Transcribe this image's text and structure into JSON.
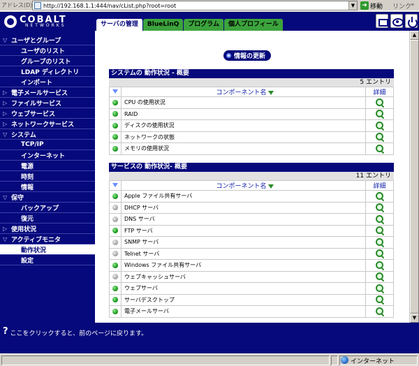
{
  "browser": {
    "address_label": "アドレス(D)",
    "url": "http://192.168.1.1:444/nav/cList.php?root=root",
    "go_label": "移動",
    "links_label": "リンク"
  },
  "brand": {
    "main": "COBALT",
    "sub": "NETWORKS"
  },
  "tabs": [
    {
      "label": "サーバの管理",
      "active": true
    },
    {
      "label": "BlueLinQ",
      "active": false
    },
    {
      "label": "プログラム",
      "active": false
    },
    {
      "label": "個人プロフィール",
      "active": false
    }
  ],
  "sidebar": {
    "items": [
      {
        "label": "ユーザとグループ",
        "level": 0,
        "expanded": true
      },
      {
        "label": "ユーザのリスト",
        "level": 1
      },
      {
        "label": "グループのリスト",
        "level": 1
      },
      {
        "label": "LDAP ディレクトリ",
        "level": 1
      },
      {
        "label": "インポート",
        "level": 1
      },
      {
        "label": "電子メールサービス",
        "level": 0,
        "expanded": false
      },
      {
        "label": "ファイルサービス",
        "level": 0,
        "expanded": false
      },
      {
        "label": "ウェブサービス",
        "level": 0,
        "expanded": false
      },
      {
        "label": "ネットワークサービス",
        "level": 0,
        "expanded": false
      },
      {
        "label": "システム",
        "level": 0,
        "expanded": true
      },
      {
        "label": "TCP/IP",
        "level": 1
      },
      {
        "label": "インターネット",
        "level": 1
      },
      {
        "label": "電源",
        "level": 1
      },
      {
        "label": "時刻",
        "level": 1
      },
      {
        "label": "情報",
        "level": 1
      },
      {
        "label": "保守",
        "level": 0,
        "expanded": true
      },
      {
        "label": "バックアップ",
        "level": 1
      },
      {
        "label": "復元",
        "level": 1
      },
      {
        "label": "使用状況",
        "level": 0,
        "expanded": false
      },
      {
        "label": "アクティブモニタ",
        "level": 0,
        "expanded": true
      },
      {
        "label": "動作状況",
        "level": 1,
        "selected": true
      },
      {
        "label": "設定",
        "level": 1
      }
    ]
  },
  "main": {
    "refresh_label": "情報の更新",
    "system_section": {
      "title": "システムの 動作状況 - 概要",
      "count": "5 エントリ",
      "col_name": "コンポーネント名",
      "col_detail": "詳細",
      "rows": [
        {
          "name": "CPU の使用状況",
          "status": "green"
        },
        {
          "name": "RAID",
          "status": "green"
        },
        {
          "name": "ディスクの使用状況",
          "status": "green"
        },
        {
          "name": "ネットワークの状態",
          "status": "green"
        },
        {
          "name": "メモリの使用状況",
          "status": "green"
        }
      ]
    },
    "service_section": {
      "title": "サービスの 動作状況- 概要",
      "count": "11 エントリ",
      "col_name": "コンポーネント名",
      "col_detail": "詳細",
      "rows": [
        {
          "name": "Apple ファイル共有サーバ",
          "status": "green"
        },
        {
          "name": "DHCP サーバ",
          "status": "gray"
        },
        {
          "name": "DNS サーバ",
          "status": "gray"
        },
        {
          "name": "FTP サーバ",
          "status": "green"
        },
        {
          "name": "SNMP サーバ",
          "status": "gray"
        },
        {
          "name": "Telnet サーバ",
          "status": "gray"
        },
        {
          "name": "Windows ファイル共有サーバ",
          "status": "green"
        },
        {
          "name": "ウェブキャッシュサーバ",
          "status": "gray"
        },
        {
          "name": "ウェブサーバ",
          "status": "green"
        },
        {
          "name": "サーバデスクトップ",
          "status": "green"
        },
        {
          "name": "電子メールサーバ",
          "status": "green"
        }
      ]
    }
  },
  "help": {
    "text": "ここをクリックすると、前のページに戻ります。"
  },
  "status": {
    "zone": "インターネット"
  },
  "colors": {
    "navy": "#06097b",
    "tab_green": "#2a9a2a",
    "status_green": "#1f9a1f",
    "status_gray": "#a8a8a8"
  }
}
